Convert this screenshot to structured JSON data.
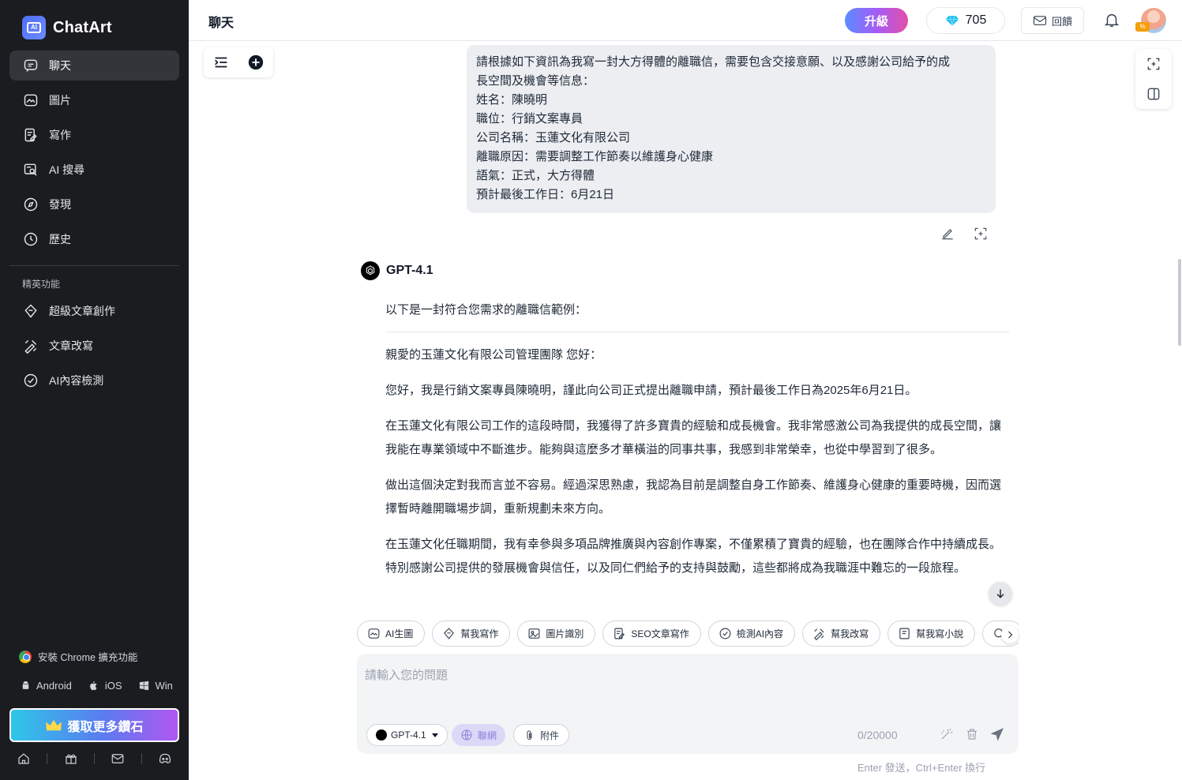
{
  "brand": {
    "name": "ChatArt"
  },
  "sidebar": {
    "nav": [
      {
        "label": "聊天",
        "icon": "chat-icon",
        "active": true
      },
      {
        "label": "圖片",
        "icon": "image-icon",
        "active": false
      },
      {
        "label": "寫作",
        "icon": "write-icon",
        "active": false
      },
      {
        "label": "AI 搜尋",
        "icon": "ai-search-icon",
        "active": false
      },
      {
        "label": "發現",
        "icon": "compass-icon",
        "active": false
      },
      {
        "label": "歷史",
        "icon": "history-icon",
        "active": false
      }
    ],
    "section_label": "精英功能",
    "elite": [
      {
        "label": "超級文章創作",
        "icon": "diamond-pen-icon"
      },
      {
        "label": "文章改寫",
        "icon": "rewrite-icon"
      },
      {
        "label": "AI內容檢測",
        "icon": "check-circle-icon"
      }
    ],
    "chrome_ext": "安裝 Chrome 擴充功能",
    "platforms": {
      "android": "Android",
      "ios": "iOS",
      "win": "Win"
    },
    "get_more": "獲取更多鑽石"
  },
  "header": {
    "title": "聊天",
    "upgrade": "升級",
    "diamonds": "705",
    "feedback": "回饋",
    "avatar_badge": "%"
  },
  "user_message": {
    "lines": [
      "請根據如下資訊為我寫一封大方得體的離職信，需要包含交接意願、以及感謝公司給予的成",
      "長空間及機會等信息：",
      "姓名：陳曉明",
      "職位：行銷文案專員",
      "公司名稱：玉蓮文化有限公司",
      "離職原因：需要調整工作節奏以維護身心健康",
      "語氣：正式，大方得體",
      "預計最後工作日：6月21日"
    ]
  },
  "bot": {
    "name": "GPT-4.1",
    "intro": "以下是一封符合您需求的離職信範例：",
    "paragraphs": [
      "親愛的玉蓮文化有限公司管理團隊 您好：",
      "您好，我是行銷文案專員陳曉明，謹此向公司正式提出離職申請，預計最後工作日為2025年6月21日。",
      "在玉蓮文化有限公司工作的這段時間，我獲得了許多寶貴的經驗和成長機會。我非常感激公司為我提供的成長空間，讓我能在專業領域中不斷進步。能夠與這麼多才華橫溢的同事共事，我感到非常榮幸，也從中學習到了很多。",
      "做出這個決定對我而言並不容易。經過深思熟慮，我認為目前是調整自身工作節奏、維護身心健康的重要時機，因而選擇暫時離開職場步調，重新規劃未來方向。",
      "在玉蓮文化任職期間，我有幸參與多項品牌推廣與內容創作專案，不僅累積了寶貴的經驗，也在團隊合作中持續成長。特別感謝公司提供的發展機會與信任，以及同仁們給予的支持與鼓勵，這些都將成為我職涯中難忘的一段旅程。"
    ]
  },
  "quick_tools": [
    {
      "label": "AI生圖",
      "icon": "image-gen-icon"
    },
    {
      "label": "幫我寫作",
      "icon": "pen-icon"
    },
    {
      "label": "圖片識別",
      "icon": "image-recognize-icon"
    },
    {
      "label": "SEO文章寫作",
      "icon": "seo-doc-icon"
    },
    {
      "label": "檢測AI內容",
      "icon": "check-circle-icon"
    },
    {
      "label": "幫我改寫",
      "icon": "rewrite-icon"
    },
    {
      "label": "幫我寫小說",
      "icon": "book-icon"
    },
    {
      "label": "",
      "icon": "search-icon"
    }
  ],
  "composer": {
    "placeholder": "請輸入您的問題",
    "model": "GPT-4.1",
    "web": "聯網",
    "attach": "附件",
    "count": "0/20000",
    "hint": "Enter 發送，Ctrl+Enter 換行"
  }
}
